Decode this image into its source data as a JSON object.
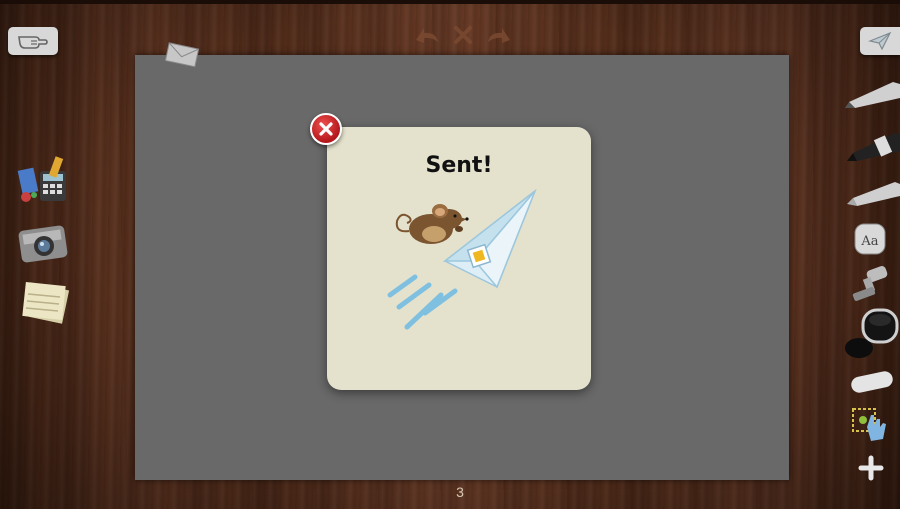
{
  "dialog": {
    "title": "Sent!"
  },
  "footer": {
    "page_number": "3"
  },
  "icons": {
    "top_left": "pointing-hand-icon",
    "top_right": "paper-plane-icon",
    "top_center": [
      "undo-icon",
      "clear-icon",
      "redo-icon"
    ],
    "left_toolbar": [
      "craft-supplies-icon",
      "camera-icon",
      "notepad-icon"
    ],
    "right_toolbar": [
      "pencil-icon",
      "marker-icon",
      "crayon-icon",
      "text-tool-icon",
      "stamp-icon",
      "ink-bucket-icon",
      "eraser-icon",
      "select-hand-icon",
      "add-icon"
    ],
    "canvas": "envelope-icon",
    "dialog_close": "close-icon",
    "dialog_art": "mouse-paper-plane-illustration"
  },
  "colors": {
    "canvas": "#696969",
    "dialog_bg": "#e4e2cd",
    "close_red": "#d32f2f",
    "plane_blue": "#7fc0e0"
  }
}
